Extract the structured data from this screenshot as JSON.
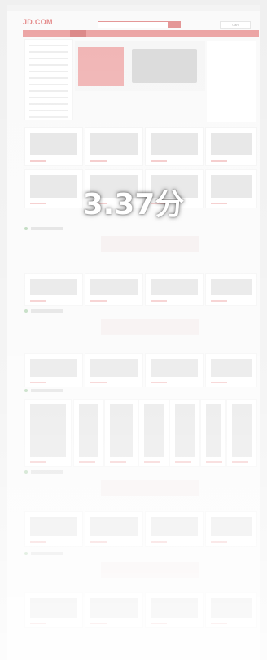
{
  "header": {
    "logo_text": "JD.COM",
    "cart_label": "Cart"
  },
  "overlay": {
    "rating_text": "3.37分"
  },
  "colors": {
    "accent": "#d65d5d",
    "background": "#f7f7f7"
  }
}
